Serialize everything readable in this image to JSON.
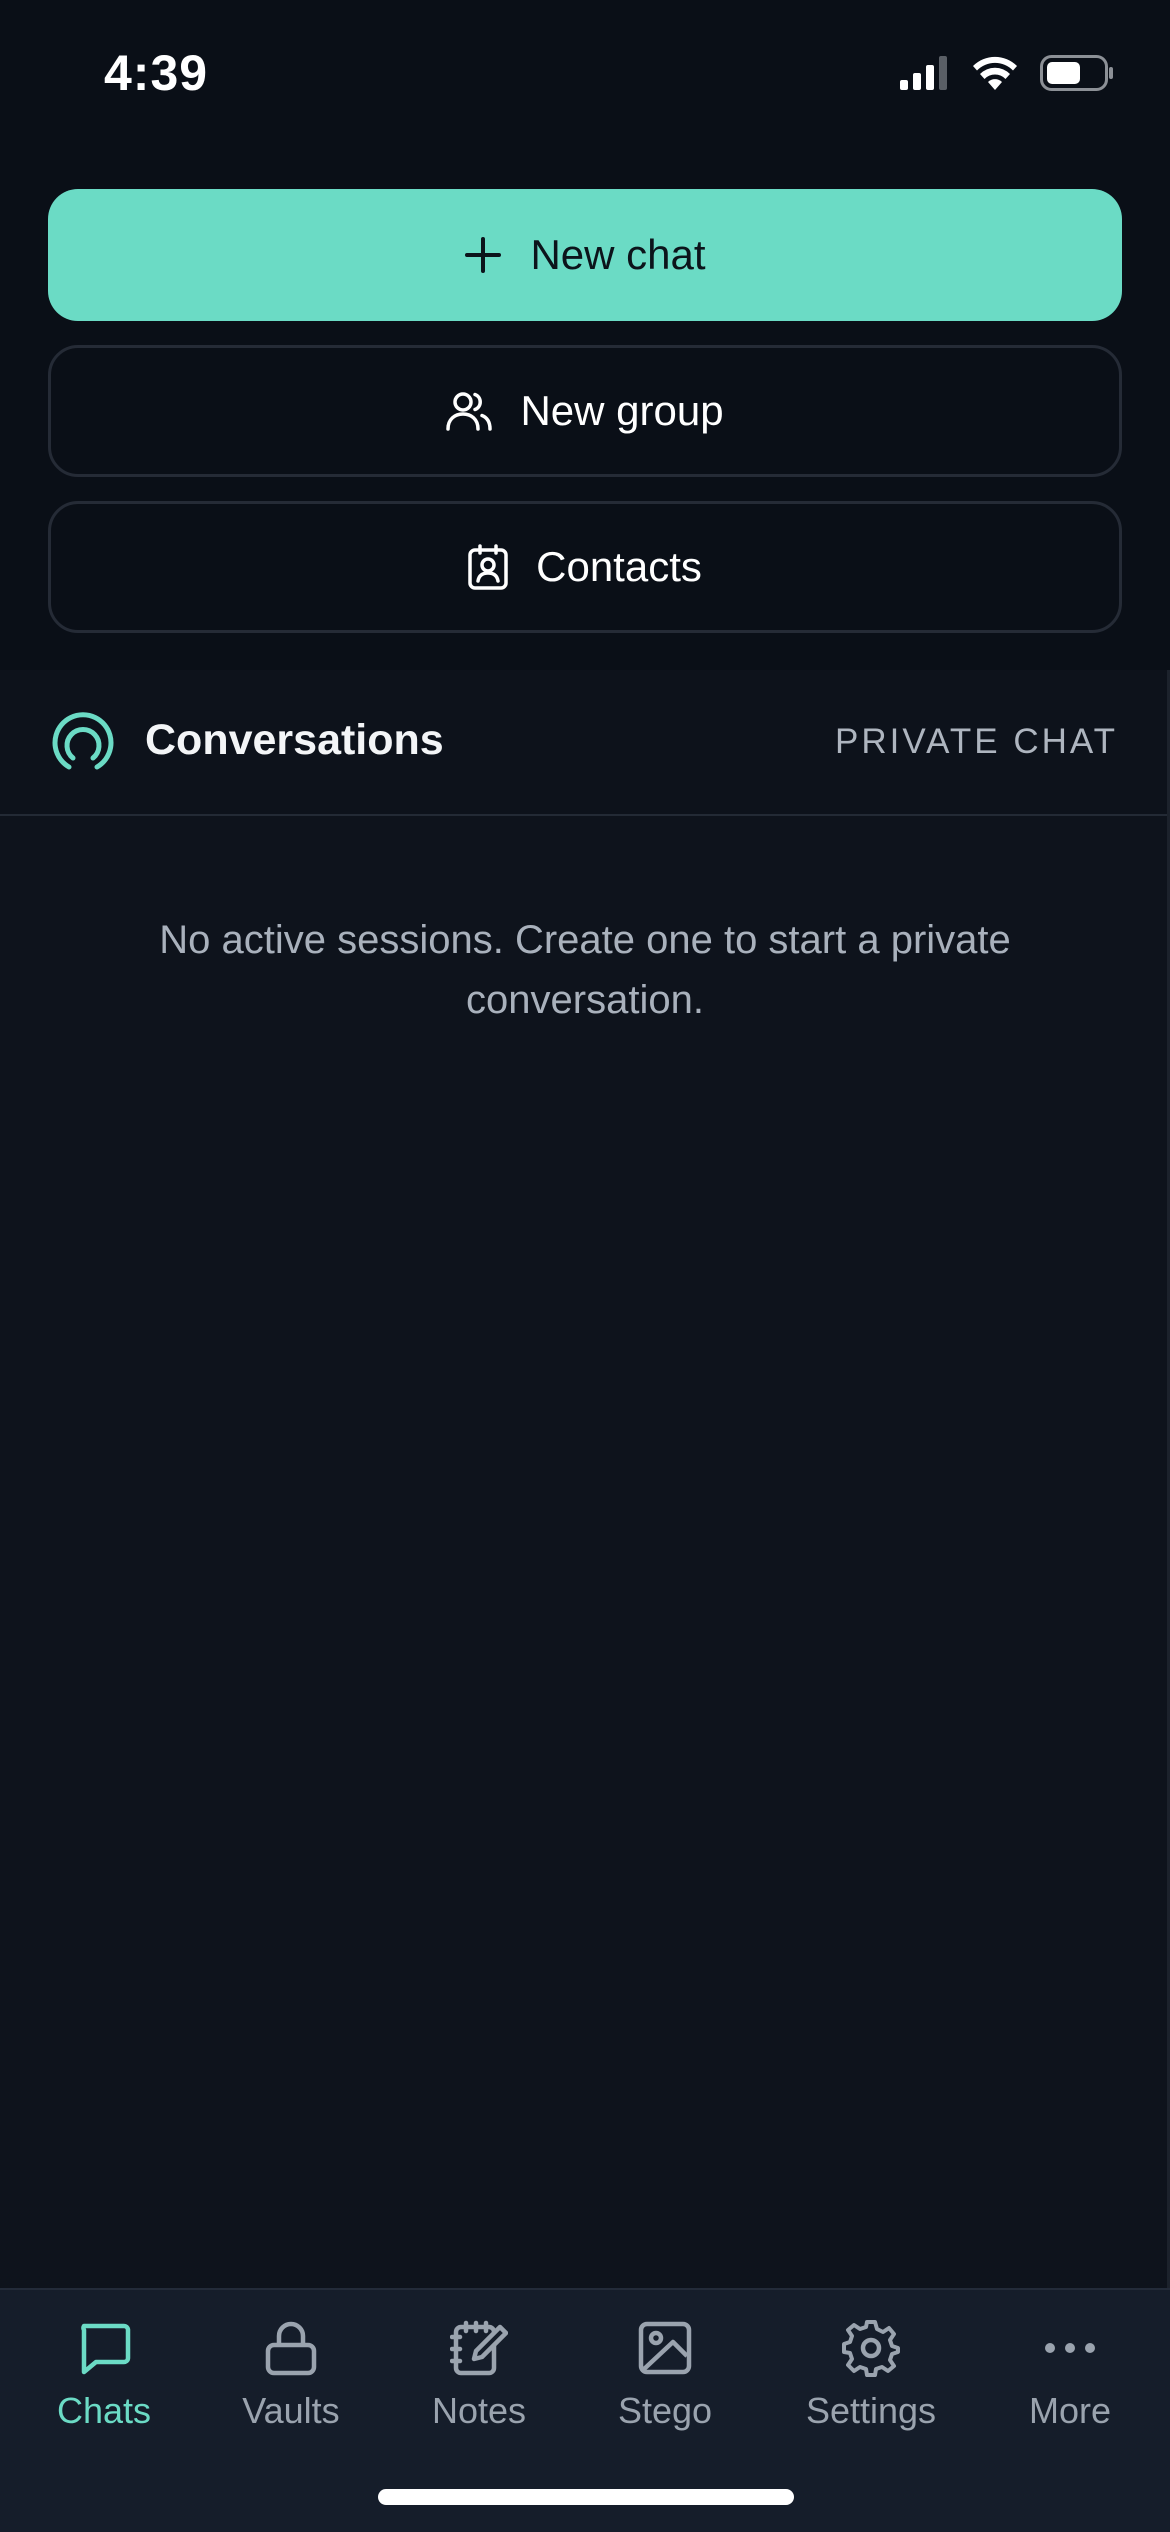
{
  "status_bar": {
    "time": "4:39"
  },
  "actions": {
    "new_chat_label": "New chat",
    "new_group_label": "New group",
    "contacts_label": "Contacts"
  },
  "conversations": {
    "title": "Conversations",
    "tag": "PRIVATE CHAT",
    "empty_message": "No active sessions. Create one to start a private conversation."
  },
  "tabs": [
    {
      "label": "Chats",
      "icon": "chat-bubble-icon",
      "active": true
    },
    {
      "label": "Vaults",
      "icon": "lock-icon",
      "active": false
    },
    {
      "label": "Notes",
      "icon": "notebook-edit-icon",
      "active": false
    },
    {
      "label": "Stego",
      "icon": "image-icon",
      "active": false
    },
    {
      "label": "Settings",
      "icon": "gear-icon",
      "active": false
    },
    {
      "label": "More",
      "icon": "more-dots-icon",
      "active": false
    }
  ],
  "colors": {
    "accent": "#6bdbc5",
    "background": "#0e131c",
    "muted_text": "#a9b1bc"
  }
}
